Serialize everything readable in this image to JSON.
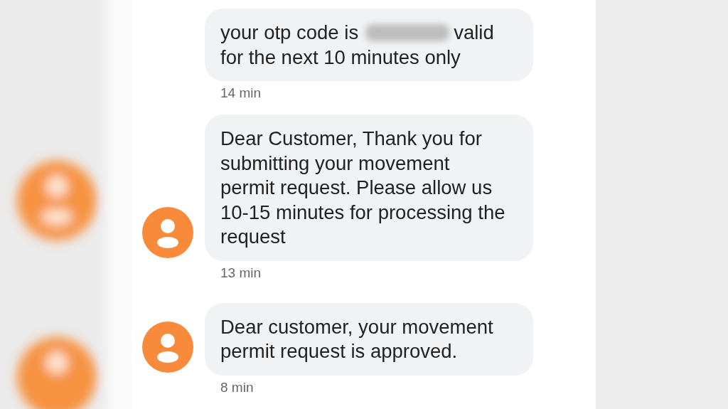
{
  "messages": [
    {
      "kind": "redacted",
      "avatar": false,
      "parts": [
        "your otp code is",
        "valid",
        "for the next 10 minutes only"
      ],
      "time": "14 min"
    },
    {
      "kind": "plain",
      "avatar": true,
      "text": "Dear Customer, Thank you for submitting your movement permit request. Please allow us 10-15 minutes for processing the request",
      "time": "13 min"
    },
    {
      "kind": "plain",
      "avatar": true,
      "text": "Dear customer, your movement permit request is approved.",
      "time": "8 min"
    }
  ]
}
